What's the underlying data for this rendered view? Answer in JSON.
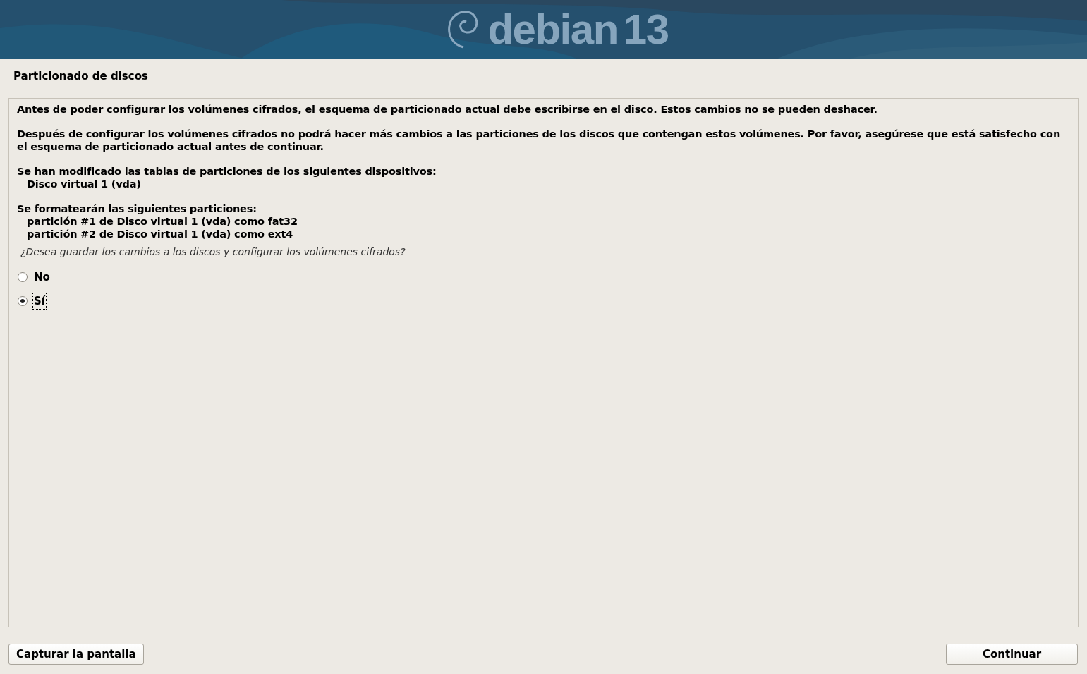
{
  "header": {
    "logo_text": "debian",
    "version": "13"
  },
  "title": "Particionado de discos",
  "paragraphs": [
    {
      "text": "Antes de poder configurar los volúmenes cifrados, el esquema de particionado actual debe escribirse en el disco.  Estos cambios no se pueden deshacer."
    },
    {
      "text": "Después de configurar los volúmenes cifrados no podrá hacer más cambios a las particiones de los discos que contengan estos volúmenes. Por favor, asegúrese que está satisfecho con el esquema de particionado actual antes de continuar."
    },
    {
      "text": "Se han modificado las tablas de particiones de los siguientes dispositivos:",
      "items": [
        "Disco virtual 1 (vda)"
      ]
    },
    {
      "text": "Se formatearán las siguientes particiones:",
      "items": [
        "partición #1 de Disco virtual 1 (vda) como fat32",
        "partición #2 de Disco virtual 1 (vda) como ext4"
      ]
    }
  ],
  "question": "¿Desea guardar los cambios a los discos y configurar los volúmenes cifrados?",
  "options": [
    {
      "label": "No",
      "selected": false
    },
    {
      "label": "Sí",
      "selected": true
    }
  ],
  "buttons": {
    "left": "Capturar la pantalla",
    "right": "Continuar"
  }
}
